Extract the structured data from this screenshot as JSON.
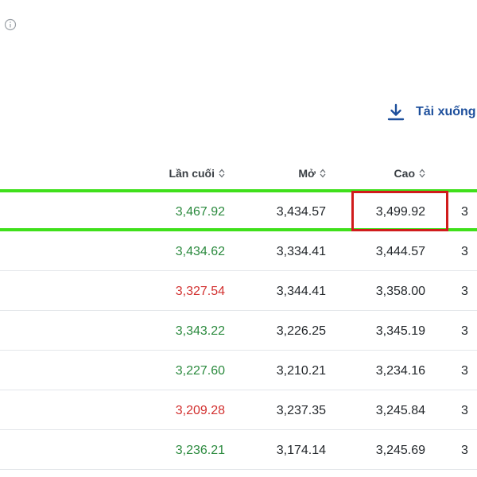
{
  "download": {
    "label": "Tải xuống"
  },
  "columns": {
    "last": "Lần cuối",
    "open": "Mở",
    "high": "Cao"
  },
  "rows": [
    {
      "last": "3,467.92",
      "last_dir": "up",
      "open": "3,434.57",
      "high": "3,499.92",
      "next": "3"
    },
    {
      "last": "3,434.62",
      "last_dir": "up",
      "open": "3,334.41",
      "high": "3,444.57",
      "next": "3"
    },
    {
      "last": "3,327.54",
      "last_dir": "down",
      "open": "3,344.41",
      "high": "3,358.00",
      "next": "3"
    },
    {
      "last": "3,343.22",
      "last_dir": "up",
      "open": "3,226.25",
      "high": "3,345.19",
      "next": "3"
    },
    {
      "last": "3,227.60",
      "last_dir": "up",
      "open": "3,210.21",
      "high": "3,234.16",
      "next": "3"
    },
    {
      "last": "3,209.28",
      "last_dir": "down",
      "open": "3,237.35",
      "high": "3,245.84",
      "next": "3"
    },
    {
      "last": "3,236.21",
      "last_dir": "up",
      "open": "3,174.14",
      "high": "3,245.69",
      "next": "3"
    }
  ],
  "colors": {
    "up": "#2b8a3e",
    "down": "#d2302f",
    "link": "#1d4f9c",
    "highlight_row": "#3fe01b",
    "highlight_cell": "#d01c1c"
  },
  "icons": {
    "info": "info-icon",
    "download": "download-icon",
    "sort": "sort-icon"
  }
}
